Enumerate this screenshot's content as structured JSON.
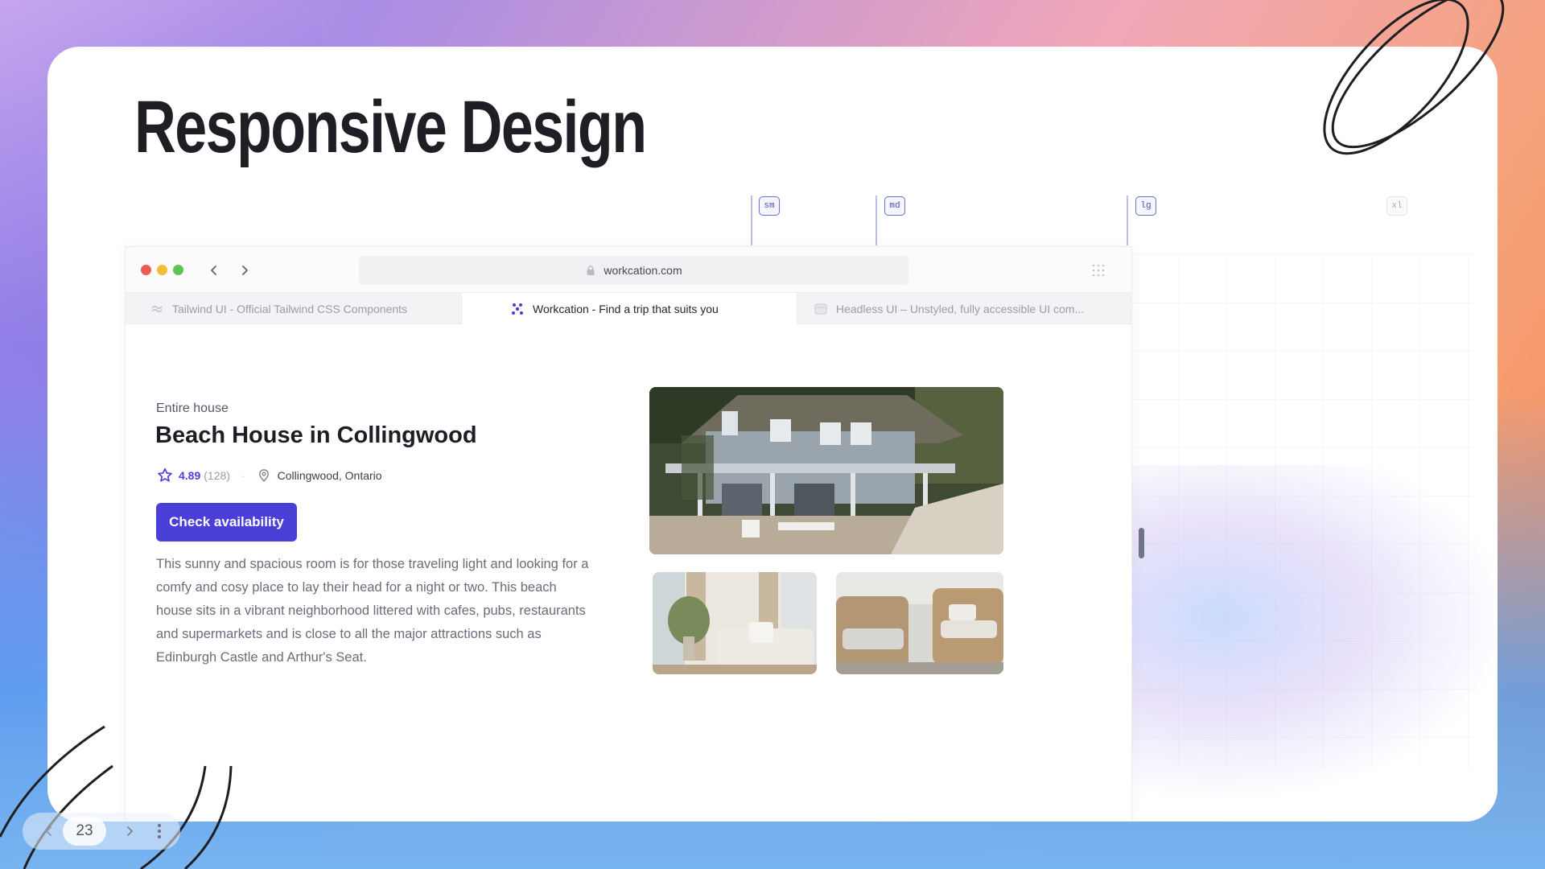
{
  "slide": {
    "title": "Responsive Design",
    "page_number": "23"
  },
  "breakpoints": [
    {
      "label": "sm"
    },
    {
      "label": "md"
    },
    {
      "label": "lg"
    },
    {
      "label": "xl"
    }
  ],
  "browser": {
    "url": "workcation.com",
    "tabs": [
      {
        "label": "Tailwind UI - Official Tailwind CSS Components"
      },
      {
        "label": "Workcation - Find a trip that suits you"
      },
      {
        "label": "Headless UI – Unstyled, fully accessible UI com..."
      }
    ]
  },
  "listing": {
    "kicker": "Entire house",
    "title": "Beach House in Collingwood",
    "rating": "4.89",
    "review_count": "(128)",
    "location": "Collingwood, Ontario",
    "cta": "Check availability",
    "description": "This sunny and spacious room is for those traveling light and looking for a comfy and cosy place to lay their head for a night or two. This beach house sits in a vibrant neighborhood littered with cafes, pubs, restaurants and supermarkets and is close to all the major attractions such as Edinburgh Castle and Arthur's Seat."
  },
  "colors": {
    "accent": "#4a3fd6",
    "title_text": "#1e1e24"
  },
  "icons": [
    "star-icon",
    "location-pin-icon",
    "lock-icon",
    "grid-dots-icon",
    "chevron-left-icon",
    "chevron-right-icon",
    "more-vertical-icon"
  ]
}
